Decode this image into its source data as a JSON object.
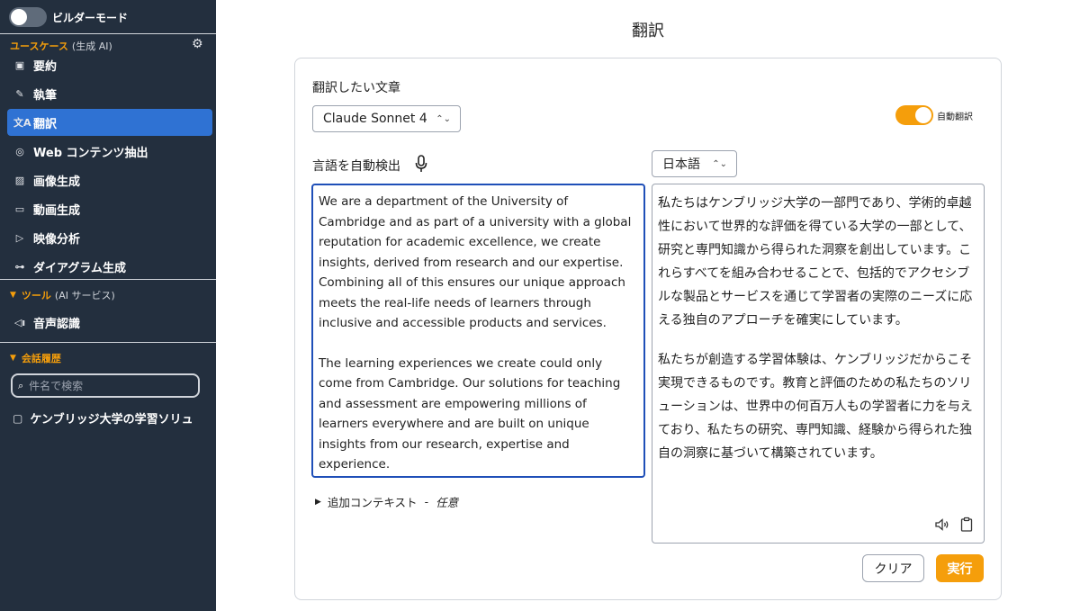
{
  "sidebar": {
    "builder_mode_label": "ビルダーモード",
    "usecase_section": {
      "title": "ユースケース",
      "subtitle": "(生成 AI)"
    },
    "usecase_items": [
      {
        "label": "要約",
        "icon": "summary-icon"
      },
      {
        "label": "執筆",
        "icon": "pen-icon"
      },
      {
        "label": "翻訳",
        "icon": "translate-icon",
        "active": true
      },
      {
        "label": "Web コンテンツ抽出",
        "icon": "globe-icon"
      },
      {
        "label": "画像生成",
        "icon": "image-icon"
      },
      {
        "label": "動画生成",
        "icon": "video-icon"
      },
      {
        "label": "映像分析",
        "icon": "camera-icon"
      },
      {
        "label": "ダイアグラム生成",
        "icon": "diagram-icon"
      }
    ],
    "tools_section": {
      "title": "ツール",
      "subtitle": "(AI サービス)"
    },
    "tools_items": [
      {
        "label": "音声認識",
        "icon": "speaker-icon"
      }
    ],
    "history_section": {
      "title": "会話履歴"
    },
    "search_placeholder": "件名で検索",
    "history_items": [
      {
        "label": "ケンブリッジ大学の学習ソリュ",
        "icon": "chat-bubble-icon"
      }
    ]
  },
  "page": {
    "title": "翻訳",
    "source_label": "翻訳したい文章",
    "model_select": "Claude Sonnet 4",
    "auto_translate_label": "自動翻訳",
    "auto_translate_on": true,
    "source_lang_label": "言語を自動検出",
    "target_lang_select": "日本語",
    "source_paragraphs": [
      "We are a department of the University of Cambridge and as part of a university with a global reputation for academic excellence, we create insights, derived from research and our expertise. Combining all of this ensures our unique approach meets the real-life needs of learners through inclusive and accessible products and services.",
      "The learning experiences we create could only come from Cambridge. Our solutions for teaching and assessment are empowering millions of learners everywhere and are built on unique insights from our research, expertise and experience."
    ],
    "translated_paragraphs": [
      "私たちはケンブリッジ大学の一部門であり、学術的卓越性において世界的な評価を得ている大学の一部として、研究と専門知識から得られた洞察を創出しています。これらすべてを組み合わせることで、包括的でアクセシブルな製品とサービスを通じて学習者の実際のニーズに応える独自のアプローチを確実にしています。",
      "私たちが創造する学習体験は、ケンブリッジだからこそ実現できるものです。教育と評価のための私たちのソリューションは、世界中の何百万人もの学習者に力を与えており、私たちの研究、専門知識、経験から得られた独自の洞察に基づいて構築されています。"
    ],
    "additional_context_label": "追加コンテキスト",
    "additional_context_sep": "-",
    "additional_context_optional": "任意",
    "clear_button": "クリア",
    "run_button": "実行"
  },
  "colors": {
    "sidebar_bg": "#232f3e",
    "accent": "#f59e0b",
    "active_nav": "#2f72d3",
    "focus_border": "#1f4fb8"
  }
}
